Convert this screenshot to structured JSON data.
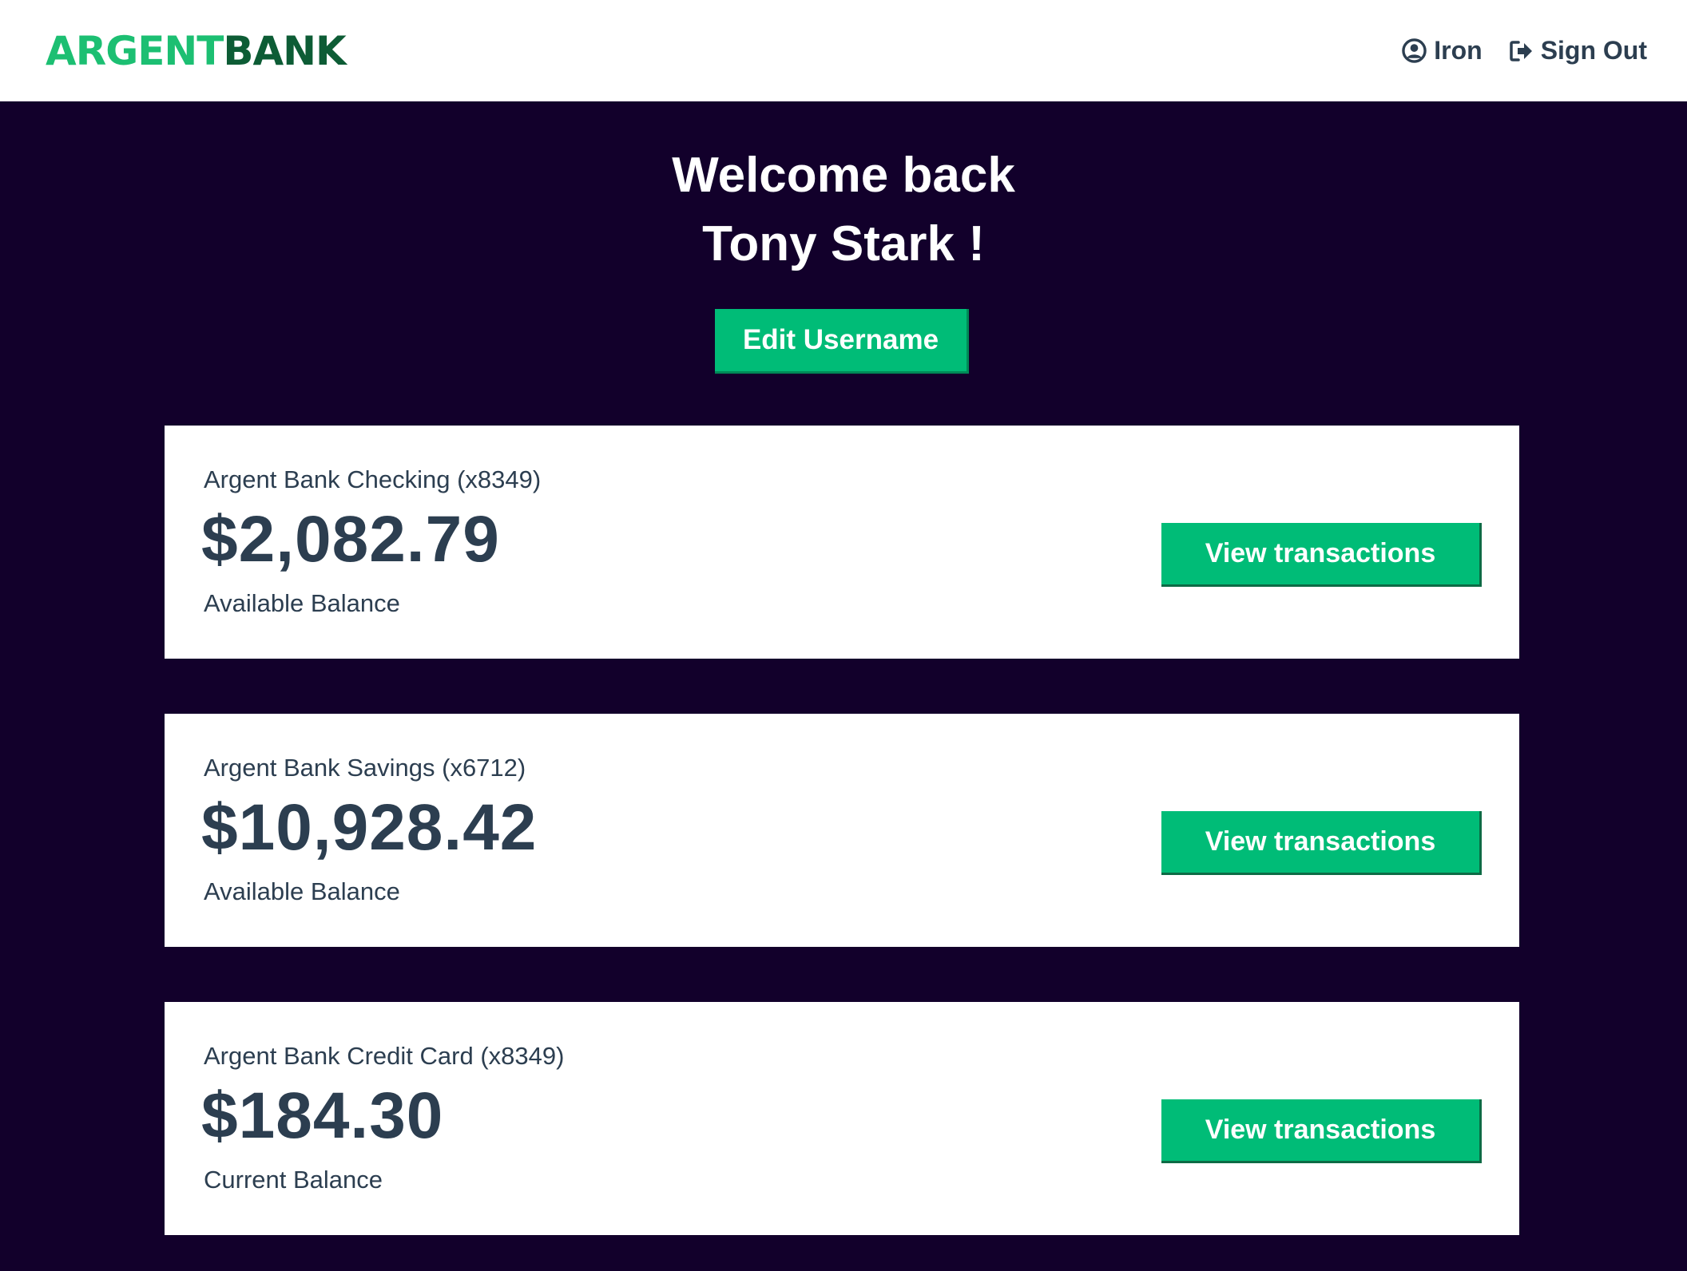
{
  "brand": {
    "part1": "ARGENT",
    "part2": "BANK"
  },
  "nav": {
    "user_name": "Iron",
    "signout_label": "Sign Out"
  },
  "welcome": {
    "line1": "Welcome back",
    "line2": "Tony Stark !",
    "edit_button": "Edit Username"
  },
  "accounts": [
    {
      "title": "Argent Bank Checking (x8349)",
      "amount": "$2,082.79",
      "description": "Available Balance",
      "button": "View transactions"
    },
    {
      "title": "Argent Bank Savings (x6712)",
      "amount": "$10,928.42",
      "description": "Available Balance",
      "button": "View transactions"
    },
    {
      "title": "Argent Bank Credit Card (x8349)",
      "amount": "$184.30",
      "description": "Current Balance",
      "button": "View transactions"
    }
  ],
  "colors": {
    "brand_green": "#1cbf72",
    "brand_dark_green": "#0d5c35",
    "button_green": "#00bc77",
    "background": "#12002b",
    "text_dark": "#2c3e50"
  },
  "icons": {
    "user": "user-circle-icon",
    "signout": "sign-out-icon"
  }
}
